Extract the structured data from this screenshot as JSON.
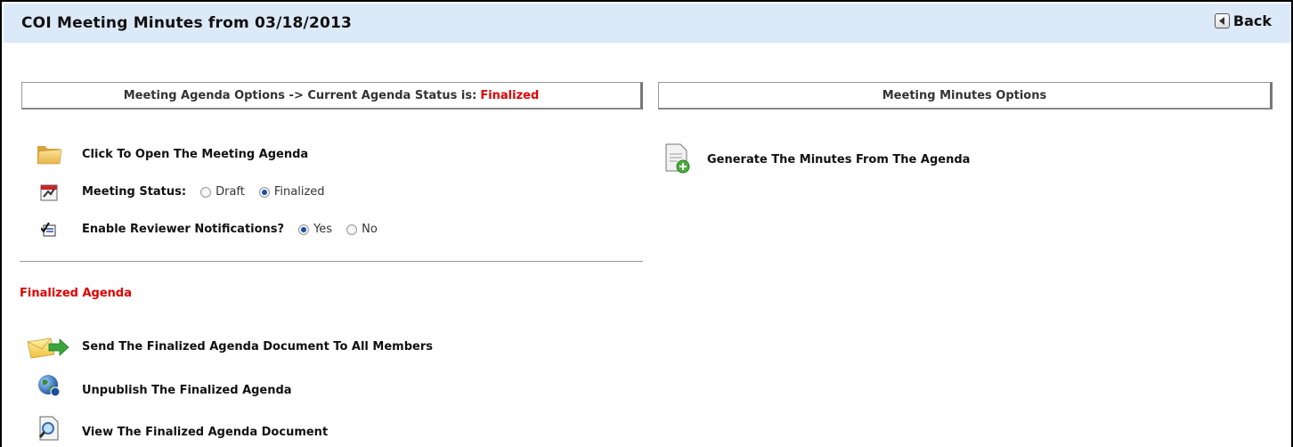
{
  "header": {
    "title": "COI Meeting Minutes from 03/18/2013",
    "back_label": "Back"
  },
  "agenda_options": {
    "header_prefix": "Meeting Agenda Options -> Current Agenda Status is:",
    "status": "Finalized",
    "open_agenda_label": "Click To Open The Meeting Agenda",
    "meeting_status": {
      "label": "Meeting Status:",
      "options": [
        "Draft",
        "Finalized"
      ],
      "selected": "Finalized"
    },
    "reviewer_notifications": {
      "label": "Enable Reviewer Notifications?",
      "options": [
        "Yes",
        "No"
      ],
      "selected": "Yes"
    }
  },
  "finalized_agenda": {
    "title": "Finalized Agenda",
    "actions": [
      {
        "label": "Send The Finalized Agenda Document To All Members",
        "icon": "envelope-arrow-icon"
      },
      {
        "label": "Unpublish The Finalized Agenda",
        "icon": "globe-icon"
      },
      {
        "label": "View The Finalized Agenda Document",
        "icon": "document-magnifier-icon"
      }
    ]
  },
  "minutes_options": {
    "header": "Meeting Minutes Options",
    "generate_label": "Generate The Minutes From The Agenda"
  },
  "colors": {
    "header_bg": "#dce9f8",
    "status_red": "#e00000",
    "radio_selected": "#1a4fa0"
  }
}
